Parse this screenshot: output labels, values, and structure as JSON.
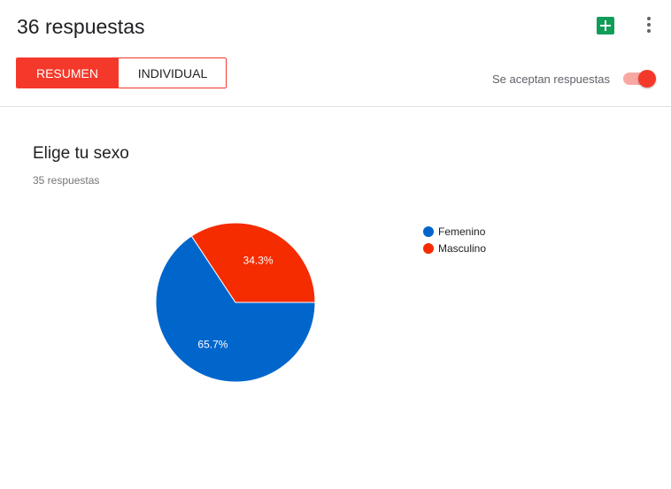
{
  "header": {
    "title": "36 respuestas",
    "tabs": [
      {
        "label": "RESUMEN",
        "active": true
      },
      {
        "label": "INDIVIDUAL",
        "active": false
      }
    ],
    "accepting_label": "Se aceptan respuestas",
    "accepting_on": true,
    "icons": [
      "sheets-icon",
      "more-vert-icon"
    ]
  },
  "question": {
    "title": "Elige tu sexo",
    "count_label": "35 respuestas"
  },
  "colors": {
    "accent": "#f4392b",
    "femenino": "#0066cc",
    "masculino": "#f42c00"
  },
  "chart_data": {
    "type": "pie",
    "categories": [
      "Femenino",
      "Masculino"
    ],
    "values": [
      65.7,
      34.3
    ],
    "labels": [
      "65.7%",
      "34.3%"
    ],
    "colors": [
      "#0066cc",
      "#f42c00"
    ],
    "legend": "right"
  }
}
